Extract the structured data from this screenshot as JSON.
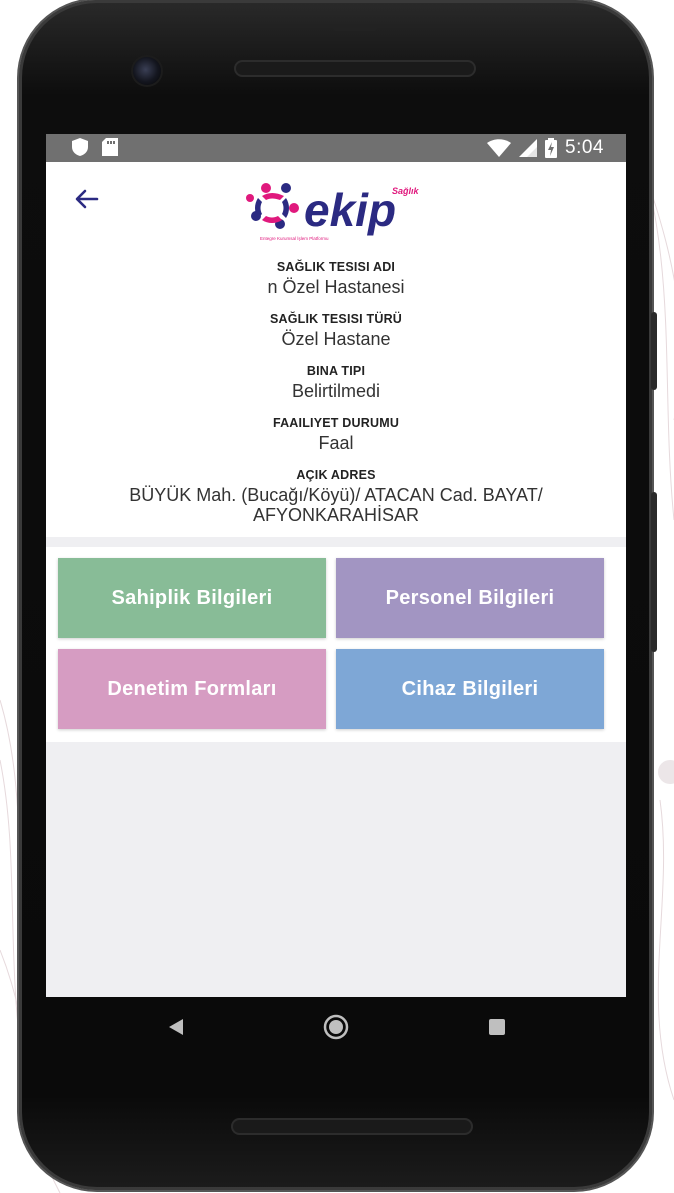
{
  "status_bar": {
    "time": "5:04",
    "icons": [
      "shield-icon",
      "sim-card-icon",
      "wifi-icon",
      "signal-icon",
      "battery-charging-icon"
    ]
  },
  "header": {
    "back_icon": "arrow-left-icon",
    "logo_text": "ekip",
    "logo_sup": "Sağlık",
    "logo_tagline": "Entegre Kurumsal İşlem Platformu"
  },
  "facility": {
    "name_label": "SAĞLIK TESISI ADI",
    "name_value": "n Özel Hastanesi",
    "type_label": "SAĞLIK TESISI TÜRÜ",
    "type_value": "Özel Hastane",
    "building_label": "BINA TIPI",
    "building_value": "Belirtilmedi",
    "status_label": "FAAILIYET DURUMU",
    "status_value": "Faal",
    "address_label": "AÇIK ADRES",
    "address_line1": "BÜYÜK Mah. (Bucağı/Köyü)/ ATACAN Cad.  BAYAT/",
    "address_line2": "AFYONKARAHİSAR"
  },
  "menu": {
    "ownership": "Sahiplik Bilgileri",
    "personnel": "Personel Bilgileri",
    "inspection": "Denetim Formları",
    "devices": "Cihaz Bilgileri"
  },
  "colors": {
    "ownership": "#88bc97",
    "personnel": "#a295c2",
    "inspection": "#d69cc2",
    "devices": "#7ea7d6",
    "accent": "#2b2a82",
    "logo_pink": "#e0197d"
  },
  "nav_bar": {
    "icons": [
      "back-triangle-icon",
      "home-circle-icon",
      "recents-square-icon"
    ]
  }
}
